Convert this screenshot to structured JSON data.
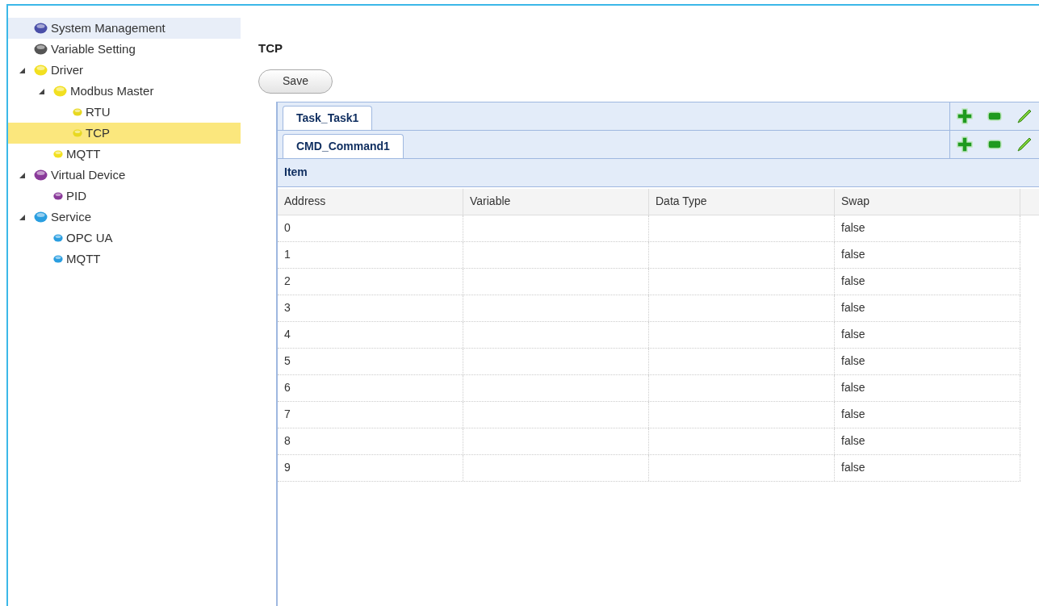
{
  "tree": [
    {
      "label": "System Management",
      "color": "#4a4fa8",
      "selected": false,
      "hovered": true
    },
    {
      "label": "Variable Setting",
      "color": "#555555",
      "selected": false
    },
    {
      "label": "Driver",
      "color": "#f2e020",
      "selected": false,
      "expanded": true,
      "children": [
        {
          "label": "Modbus Master",
          "color": "#f2e020",
          "selected": false,
          "expanded": true,
          "children": [
            {
              "label": "RTU",
              "color": "#e8d820",
              "selected": false
            },
            {
              "label": "TCP",
              "color": "#e8d820",
              "selected": true
            }
          ]
        },
        {
          "label": "MQTT",
          "color": "#f2e020",
          "selected": false
        }
      ]
    },
    {
      "label": "Virtual Device",
      "color": "#8a3a9a",
      "selected": false,
      "expanded": true,
      "children": [
        {
          "label": "PID",
          "color": "#8a3a9a",
          "selected": false
        }
      ]
    },
    {
      "label": "Service",
      "color": "#2a9ee0",
      "selected": false,
      "expanded": true,
      "children": [
        {
          "label": "OPC UA",
          "color": "#2a9ee0",
          "selected": false
        },
        {
          "label": "MQTT",
          "color": "#2a9ee0",
          "selected": false
        }
      ]
    }
  ],
  "page_title": "TCP",
  "save_button": "Save",
  "task_tabs": [
    {
      "label": "Task_Task1",
      "selected": true
    }
  ],
  "command_tabs": [
    {
      "label": "CMD_Command1",
      "selected": true
    }
  ],
  "item_header": "Item",
  "table": {
    "columns": [
      "Address",
      "Variable",
      "Data Type",
      "Swap"
    ],
    "rows": [
      [
        "0",
        "",
        "",
        "false"
      ],
      [
        "1",
        "",
        "",
        "false"
      ],
      [
        "2",
        "",
        "",
        "false"
      ],
      [
        "3",
        "",
        "",
        "false"
      ],
      [
        "4",
        "",
        "",
        "false"
      ],
      [
        "5",
        "",
        "",
        "false"
      ],
      [
        "6",
        "",
        "",
        "false"
      ],
      [
        "7",
        "",
        "",
        "false"
      ],
      [
        "8",
        "",
        "",
        "false"
      ],
      [
        "9",
        "",
        "",
        "false"
      ]
    ]
  }
}
